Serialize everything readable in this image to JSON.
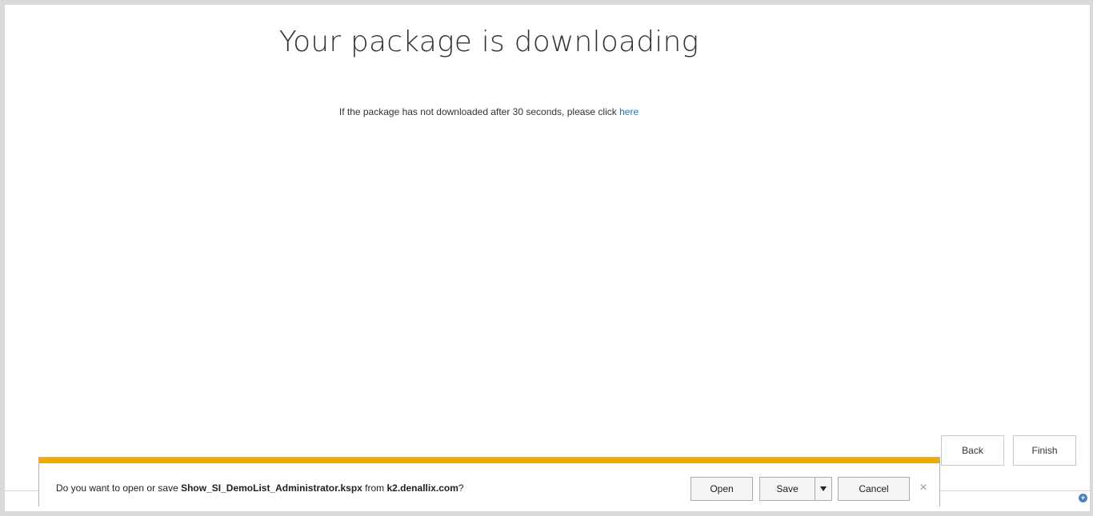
{
  "page": {
    "title": "Your package is downloading",
    "instruction_text": "If the package has not downloaded after 30 seconds, please click ",
    "instruction_link": "here"
  },
  "wizard": {
    "back_label": "Back",
    "finish_label": "Finish"
  },
  "download_bar": {
    "prompt_prefix": "Do you want to open or save ",
    "file_name": "Show_SI_DemoList_Administrator.kspx",
    "prompt_middle": " from ",
    "host": "k2.denallix.com",
    "prompt_suffix": "?",
    "open_label": "Open",
    "save_label": "Save",
    "cancel_label": "Cancel",
    "close_glyph": "×",
    "accent_color": "#f2a900",
    "icons": {
      "save_menu": "chevron-down-icon",
      "close": "close-icon"
    }
  },
  "corner_icon": {
    "glyph": "+",
    "icon": "zoom-icon"
  }
}
